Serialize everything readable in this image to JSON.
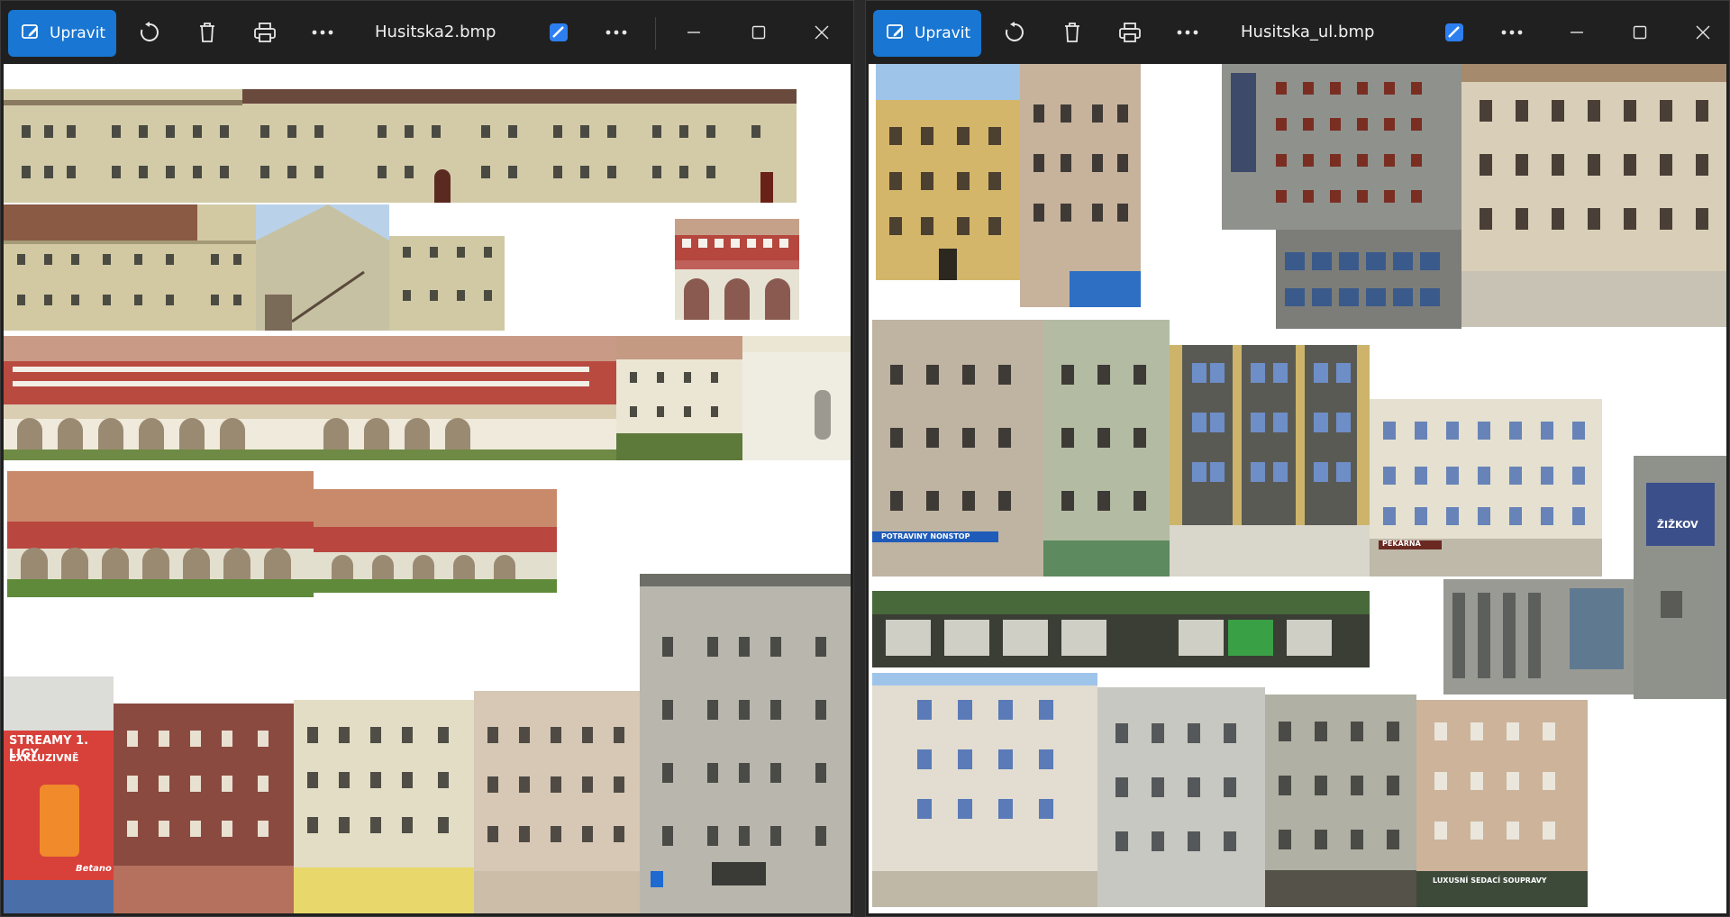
{
  "left": {
    "edit_label": "Upravit",
    "filename": "Husitska2.bmp",
    "billboard_line1": "STREAMY 1. LIGY",
    "billboard_line2": "EXKLUZIVNĚ",
    "billboard_brand": "Betano"
  },
  "right": {
    "edit_label": "Upravit",
    "filename": "Husitska_ul.bmp",
    "poster_text": "ŽIŽKOV",
    "shop_sign_1": "POTRAVINY NONSTOP",
    "shop_sign_2": "PEKÁRNA",
    "shop_sign_3": "LUXUSNÍ SEDACÍ SOUPRAVY"
  },
  "icons": [
    "edit-icon",
    "rotate-icon",
    "delete-icon",
    "print-icon",
    "more-icon",
    "designer-icon",
    "more-icon-2",
    "minimize-icon",
    "maximize-icon",
    "close-icon"
  ],
  "colors": {
    "accent": "#1976d2",
    "titlebar": "#202020",
    "canvas": "#ffffff"
  }
}
